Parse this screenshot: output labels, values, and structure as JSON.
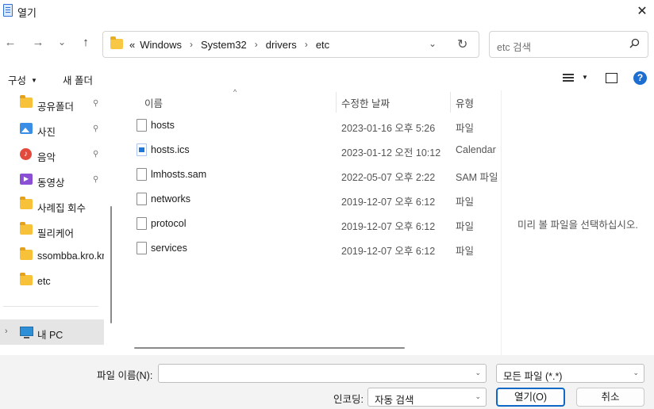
{
  "window": {
    "title": "열기",
    "close_glyph": "✕"
  },
  "nav": {
    "back_glyph": "←",
    "forward_glyph": "→",
    "recent_glyph": "⌄",
    "up_glyph": "↑",
    "breadcrumb_prefix": "«",
    "breadcrumbs": [
      "Windows",
      "System32",
      "drivers",
      "etc"
    ],
    "separator": "›",
    "dropdown_glyph": "⌄",
    "refresh_glyph": "↻"
  },
  "search": {
    "placeholder": "etc 검색"
  },
  "toolbar": {
    "organize": "구성",
    "new_folder": "새 폴더",
    "caret": "▼"
  },
  "sidebar": {
    "items": [
      {
        "label": "공유폴더",
        "icon": "folder-icon",
        "pinned": true
      },
      {
        "label": "사진",
        "icon": "pictures-icon",
        "pinned": true
      },
      {
        "label": "음악",
        "icon": "music-icon",
        "pinned": true
      },
      {
        "label": "동영상",
        "icon": "videos-icon",
        "pinned": true
      },
      {
        "label": "사례집 회수",
        "icon": "folder-icon",
        "pinned": false
      },
      {
        "label": "필리케어",
        "icon": "folder-icon",
        "pinned": false
      },
      {
        "label": "ssombba.kro.kr",
        "icon": "folder-icon",
        "pinned": false
      },
      {
        "label": "etc",
        "icon": "folder-icon",
        "pinned": false
      }
    ],
    "pin_glyph": "📌",
    "this_pc": "내 PC",
    "expand_glyph": "›"
  },
  "filelist": {
    "columns": {
      "name": "이름",
      "date": "수정한 날짜",
      "type": "유형"
    },
    "sort_glyph": "^",
    "rows": [
      {
        "name": "hosts",
        "date": "2023-01-16 오후 5:26",
        "type": "파일",
        "icon": "file-icon"
      },
      {
        "name": "hosts.ics",
        "date": "2023-01-12 오전 10:12",
        "type": "Calendar",
        "icon": "calendar-file-icon"
      },
      {
        "name": "lmhosts.sam",
        "date": "2022-05-07 오후 2:22",
        "type": "SAM 파일",
        "icon": "file-icon"
      },
      {
        "name": "networks",
        "date": "2019-12-07 오후 6:12",
        "type": "파일",
        "icon": "file-icon"
      },
      {
        "name": "protocol",
        "date": "2019-12-07 오후 6:12",
        "type": "파일",
        "icon": "file-icon"
      },
      {
        "name": "services",
        "date": "2019-12-07 오후 6:12",
        "type": "파일",
        "icon": "file-icon"
      }
    ]
  },
  "preview": {
    "message": "미리 볼 파일을 선택하십시오."
  },
  "bottom": {
    "filename_label": "파일 이름(N):",
    "filename_value": "",
    "filter_value": "모든 파일  (*.*)",
    "encoding_label": "인코딩:",
    "encoding_value": "자동 검색",
    "open_button": "열기(O)",
    "cancel_button": "취소",
    "dropdown_glyph": "⌄"
  },
  "colors": {
    "accent": "#0f68c6",
    "folder": "#f7c13a",
    "selected_bg": "#e5e5e5"
  }
}
